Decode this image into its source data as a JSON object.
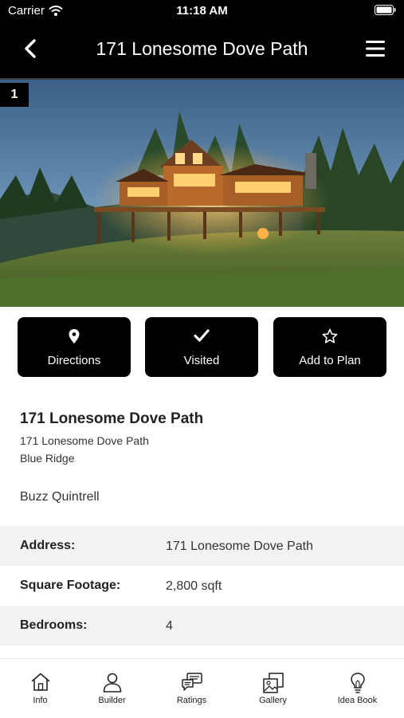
{
  "status_bar": {
    "carrier": "Carrier",
    "time": "11:18 AM"
  },
  "nav": {
    "title": "171 Lonesome Dove Path",
    "back_icon": "chevron-left-icon",
    "menu_icon": "hamburger-icon"
  },
  "hero": {
    "image_counter": "1"
  },
  "actions": [
    {
      "label": "Directions",
      "icon": "map-pin-icon"
    },
    {
      "label": "Visited",
      "icon": "checkmark-icon"
    },
    {
      "label": "Add to Plan",
      "icon": "star-outline-icon"
    }
  ],
  "home": {
    "name": "171 Lonesome Dove Path",
    "address_line1": "171 Lonesome Dove Path",
    "address_line2": "Blue Ridge",
    "builder": "Buzz Quintrell"
  },
  "details": [
    {
      "label": "Address:",
      "value": "171 Lonesome Dove Path"
    },
    {
      "label": "Square Footage:",
      "value": "2,800 sqft"
    },
    {
      "label": "Bedrooms:",
      "value": "4"
    }
  ],
  "tabs": [
    {
      "label": "Info",
      "icon": "home-icon"
    },
    {
      "label": "Builder",
      "icon": "person-icon"
    },
    {
      "label": "Ratings",
      "icon": "chat-bubbles-icon"
    },
    {
      "label": "Gallery",
      "icon": "gallery-icon"
    },
    {
      "label": "Idea Book",
      "icon": "lightbulb-icon"
    }
  ],
  "colors": {
    "bar_background": "#000000",
    "row_shade": "#f2f2f2",
    "text": "#222222"
  }
}
